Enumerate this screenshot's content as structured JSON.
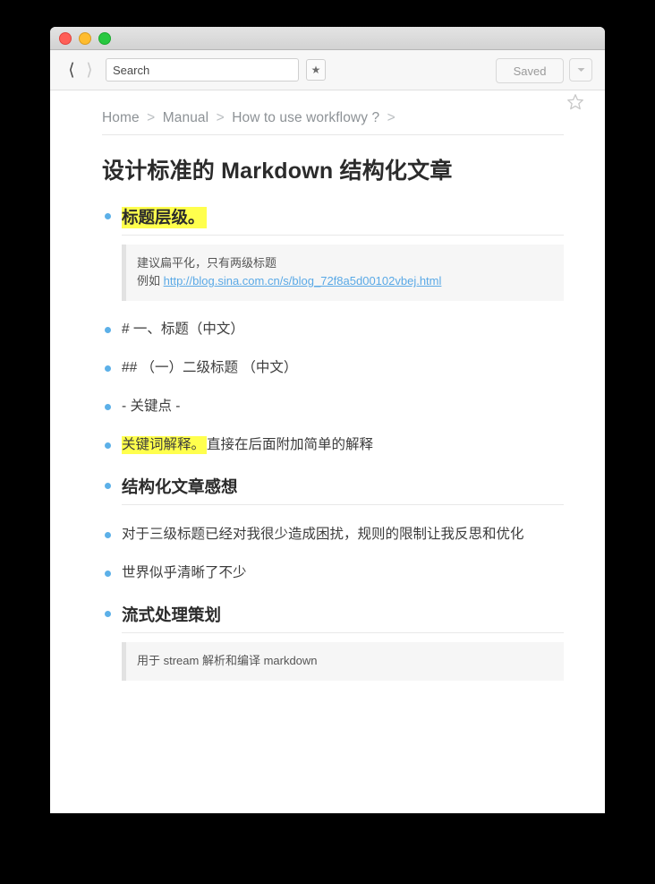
{
  "window": {
    "traffic_lights": [
      {
        "name": "close",
        "color": "#ff5f57"
      },
      {
        "name": "minimize",
        "color": "#febc2e"
      },
      {
        "name": "zoom",
        "color": "#28c840"
      }
    ]
  },
  "toolbar": {
    "back_icon": "chevron-left",
    "forward_icon": "chevron-right",
    "search_placeholder": "Search",
    "search_value": "",
    "star_icon": "★",
    "saved_label": "Saved",
    "dropdown_icon": "chevron-down"
  },
  "content": {
    "favorite_icon": "star-outline",
    "breadcrumb": {
      "separator": ">",
      "items": [
        "Home",
        "Manual",
        "How to use workflowy ?"
      ],
      "trailing_separator": ">"
    },
    "title": "设计标准的 Markdown 结构化文章",
    "nodes": [
      {
        "type": "heading",
        "text": "标题层级。",
        "highlighted": true,
        "note": {
          "line1": "建议扁平化，只有两级标题",
          "line2_prefix": "例如 ",
          "link_text": "http://blog.sina.com.cn/s/blog_72f8a5d00102vbej.html"
        }
      },
      {
        "type": "item",
        "text": "# 一、标题（中文）"
      },
      {
        "type": "item",
        "text": "## （一）二级标题 （中文）"
      },
      {
        "type": "item",
        "text": "- 关键点 -"
      },
      {
        "type": "item",
        "highlight_prefix": "关键词解释。",
        "text": "直接在后面附加简单的解释"
      },
      {
        "type": "heading",
        "text": "结构化文章感想"
      },
      {
        "type": "item",
        "text": "对于三级标题已经对我很少造成困扰，规则的限制让我反思和优化"
      },
      {
        "type": "item",
        "text": "世界似乎清晰了不少"
      },
      {
        "type": "heading",
        "text": "流式处理策划",
        "note": {
          "line1": "用于 stream 解析和编译 markdown"
        }
      }
    ]
  }
}
